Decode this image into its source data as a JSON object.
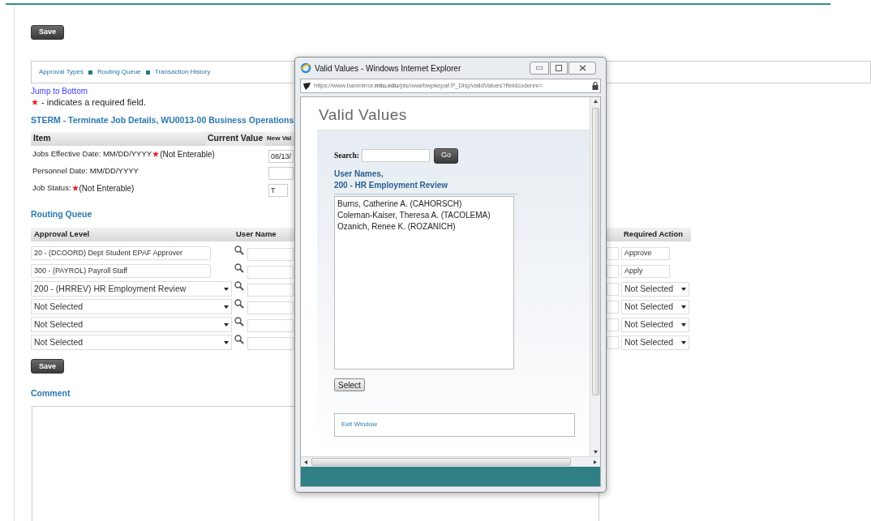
{
  "top_save": "Save",
  "nav_links": [
    "Approval Types",
    "Routing Queue",
    "Transaction History"
  ],
  "jump_link": "Jump to Bottom",
  "required_note": "- indicates a required field.",
  "title": "STERM - Terminate Job Details, WU0013-00 Business Operations",
  "details": {
    "columns": [
      "Item",
      "Current Value",
      "New Val"
    ],
    "rows": [
      {
        "item": "Jobs Effective Date: MM/DD/YYYY",
        "required": true,
        "note": "(Not Enterable)",
        "new_value": "08/13/"
      },
      {
        "item": "Personnel Date: MM/DD/YYYY",
        "required": false
      },
      {
        "item": "Job Status:",
        "required": true,
        "note": "(Not Enterable)",
        "new_value": "T"
      }
    ]
  },
  "routing": {
    "heading": "Routing Queue",
    "columns": [
      "Approval Level",
      "User Name",
      "Required Action"
    ],
    "rows": [
      {
        "level": {
          "kind": "text",
          "value": "20 - (DCOORD) Dept Student EPAF Approver"
        },
        "action": {
          "kind": "text",
          "value": "Approve"
        }
      },
      {
        "level": {
          "kind": "text",
          "value": "300 - (PAYROL) Payroll Staff"
        },
        "action": {
          "kind": "text",
          "value": "Apply"
        }
      },
      {
        "level": {
          "kind": "select",
          "value": "200 - (HRREV) HR Employment Review"
        },
        "action": {
          "kind": "select",
          "value": "Not Selected"
        }
      },
      {
        "level": {
          "kind": "select",
          "value": "Not Selected"
        },
        "action": {
          "kind": "select",
          "value": "Not Selected"
        }
      },
      {
        "level": {
          "kind": "select",
          "value": "Not Selected"
        },
        "action": {
          "kind": "select",
          "value": "Not Selected"
        }
      },
      {
        "level": {
          "kind": "select",
          "value": "Not Selected"
        },
        "action": {
          "kind": "select",
          "value": "Not Selected"
        }
      }
    ],
    "save": "Save"
  },
  "comment": {
    "heading": "Comment"
  },
  "popup": {
    "title": "Valid Values - Windows Internet Explorer",
    "url": "https://www.banmirror.**mtu.edu**/pls/owa/bwpkepaf.P_DispValidValues?fieldcodenm=",
    "heading": "Valid Values",
    "search_label": "Search:",
    "go": "Go",
    "list_caption": [
      "User Names,",
      "200 - HR Employment Review"
    ],
    "users": [
      {
        "name": "Burns, Catherine A. (CAHORSCH)",
        "selected": false
      },
      {
        "name": "Coleman-Kaiser, Theresa A. (TACOLEMA)",
        "selected": false
      },
      {
        "name": "Ozanich, Renee K. (ROZANICH)",
        "selected": false
      }
    ],
    "select": "Select",
    "exit": "Exit Window"
  }
}
